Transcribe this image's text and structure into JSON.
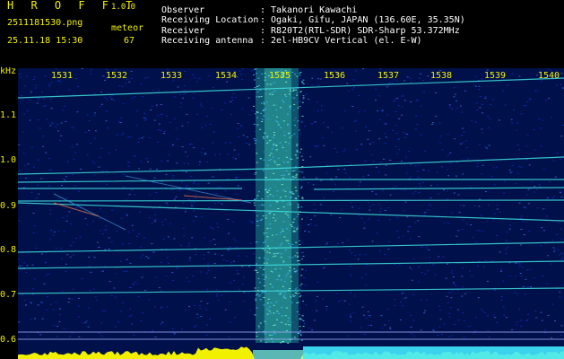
{
  "header": {
    "app_name": "H R O F F T",
    "version": "1.0.0",
    "filename": "2511181530.png",
    "detection_label": "meteor",
    "datetime": "25.11.18 15:30",
    "meteor_count": "67",
    "info": [
      {
        "label": "Observer",
        "colon": ":",
        "value": "Takanori Kawachi"
      },
      {
        "label": "Receiving Location",
        "colon": ":",
        "value": "Ogaki, Gifu, JAPAN (136.60E, 35.35N)"
      },
      {
        "label": "Receiver",
        "colon": ":",
        "value": "R820T2(RTL-SDR) SDR-Sharp 53.372MHz"
      },
      {
        "label": "Receiving antenna",
        "colon": ":",
        "value": "2el-HB9CV Vertical (el. E-W)"
      }
    ]
  },
  "spectrogram": {
    "y_unit": "kHz",
    "time_ticks": [
      "1531",
      "1532",
      "1533",
      "1534",
      "1535",
      "1536",
      "1537",
      "1538",
      "1539",
      "1540"
    ],
    "freq_ticks": [
      "1.1",
      "1.0",
      "0.9",
      "0.8",
      "0.7",
      "0.6"
    ],
    "colors": {
      "background": "#000000",
      "text": "#f0f000",
      "noise_blue": "#1030c0",
      "trace": "#40e0e0",
      "floor": "#f0f000",
      "floor_cyan": "#40e8ff"
    }
  }
}
